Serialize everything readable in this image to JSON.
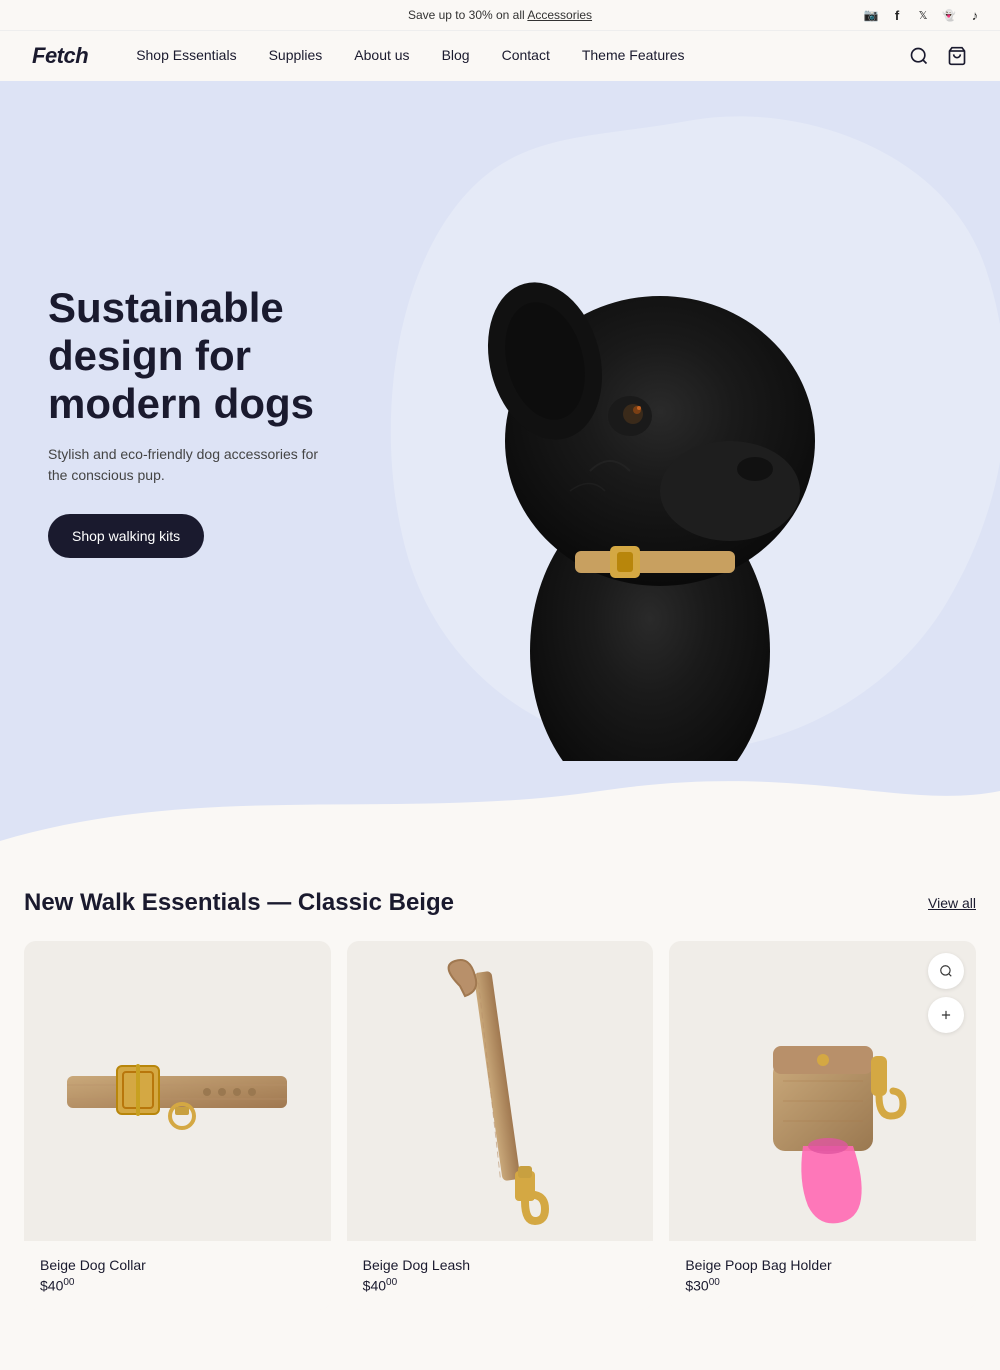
{
  "announcement": {
    "text": "Save up to 30% on all ",
    "link_text": "Accessories",
    "social_icons": [
      "instagram",
      "facebook",
      "twitter",
      "snapchat",
      "tiktok"
    ]
  },
  "nav": {
    "logo": "Fetch",
    "links": [
      {
        "label": "Shop Essentials",
        "href": "#"
      },
      {
        "label": "Supplies",
        "href": "#"
      },
      {
        "label": "About us",
        "href": "#"
      },
      {
        "label": "Blog",
        "href": "#"
      },
      {
        "label": "Contact",
        "href": "#"
      },
      {
        "label": "Theme Features",
        "href": "#"
      }
    ],
    "search_label": "Search",
    "cart_label": "Cart"
  },
  "hero": {
    "title": "Sustainable design for modern dogs",
    "subtitle": "Stylish and eco-friendly dog accessories for the conscious pup.",
    "cta_label": "Shop walking kits"
  },
  "products_section": {
    "title": "New Walk Essentials — Classic Beige",
    "view_all_label": "View all",
    "products": [
      {
        "name": "Beige Dog Collar",
        "price": "$40",
        "dollars": "40",
        "cents": "00",
        "type": "collar"
      },
      {
        "name": "Beige Dog Leash",
        "price": "$40",
        "dollars": "40",
        "cents": "00",
        "type": "leash"
      },
      {
        "name": "Beige Poop Bag Holder",
        "price": "$30",
        "dollars": "30",
        "cents": "00",
        "type": "bag-holder"
      }
    ]
  },
  "colors": {
    "hero_bg": "#dde3f5",
    "body_bg": "#faf8f5",
    "text_dark": "#1a1a2e",
    "product_bg": "#f0ede8",
    "tan": "#b8956a"
  }
}
